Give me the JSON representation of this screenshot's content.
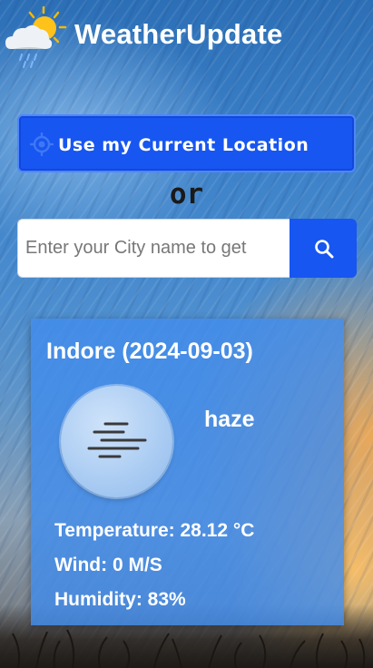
{
  "header": {
    "app_title": "WeatherUpdate",
    "logo_icon": "sun-cloud-rain-icon"
  },
  "location": {
    "button_label": "Use my Current Location",
    "icon": "crosshair-icon"
  },
  "divider_text": "or",
  "search": {
    "placeholder": "Enter your City name to get",
    "value": "",
    "icon": "search-icon"
  },
  "weather": {
    "title": "Indore (2024-09-03)",
    "condition": "haze",
    "condition_icon": "haze-icon",
    "temperature": "Temperature: 28.12 °C",
    "wind": "Wind: 0 M/S",
    "humidity": "Humidity: 83%"
  },
  "colors": {
    "accent": "#1756f0",
    "card": "#428ceb",
    "text": "#ffffff"
  }
}
